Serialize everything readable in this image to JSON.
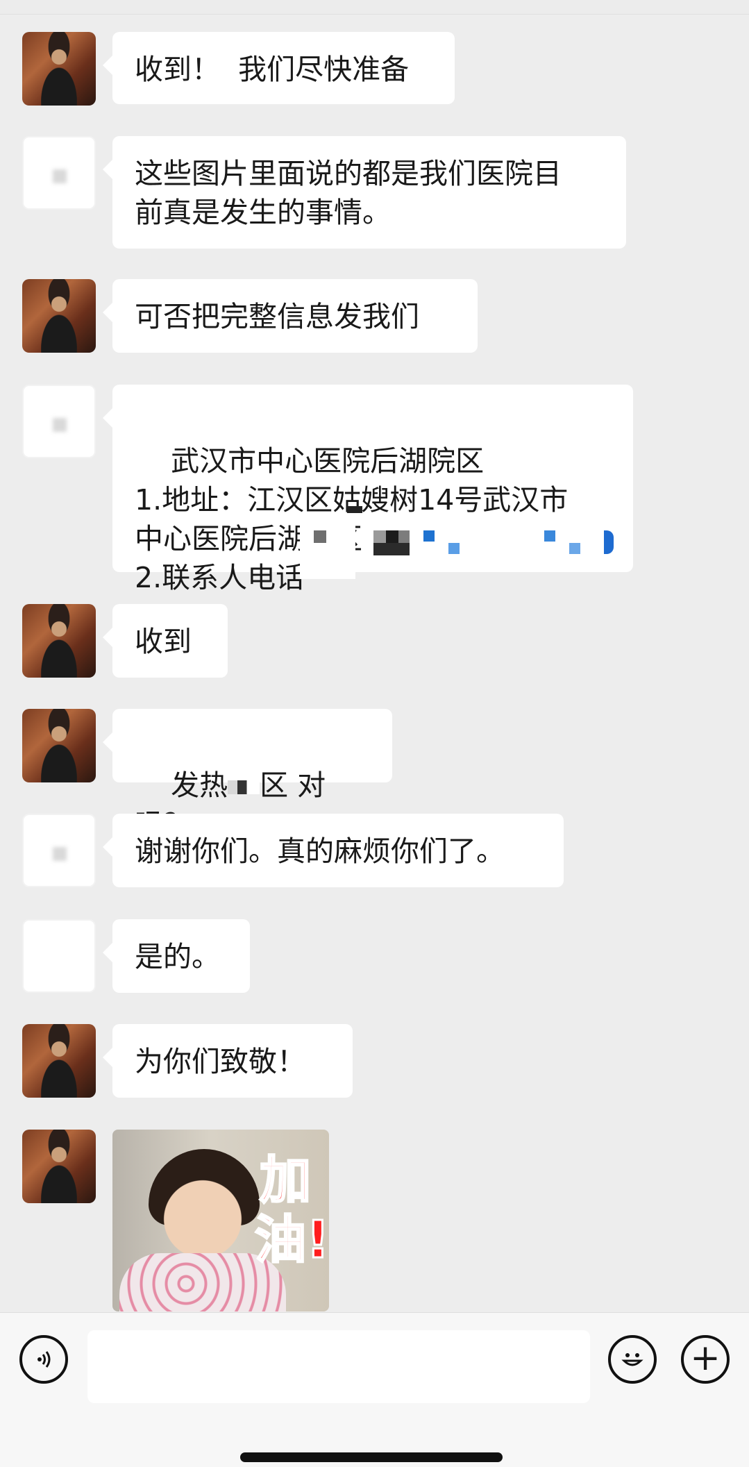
{
  "messages": [
    {
      "side": "left",
      "avatar": "photo",
      "text": "收到！  我们尽快准备"
    },
    {
      "side": "left",
      "avatar": "blank",
      "text": "这些图片里面说的都是我们医院目\n前真是发生的事情。"
    },
    {
      "side": "left",
      "avatar": "photo",
      "text": "可否把完整信息发我们"
    },
    {
      "side": "left",
      "avatar": "blank",
      "text": "武汉市中心医院后湖院区\n1.地址：江汉区姑嫂树14号武汉市\n中心医院后湖院区\n2.联系人电话"
    },
    {
      "side": "left",
      "avatar": "photo",
      "text": "收到"
    },
    {
      "side": "left",
      "avatar": "photo",
      "text": "发热",
      "text_after": "区 对吗？"
    },
    {
      "side": "left",
      "avatar": "blank",
      "text": "谢谢你们。真的麻烦你们了。"
    },
    {
      "side": "left",
      "avatar": "blank",
      "text": "是的。"
    },
    {
      "side": "left",
      "avatar": "photo",
      "text": "为你们致敬！"
    },
    {
      "side": "left",
      "avatar": "photo",
      "sticker_text": "加油!!"
    }
  ],
  "input_bar": {
    "voice_icon": "voice-icon",
    "emoji_icon": "emoji-icon",
    "plus_icon": "plus-icon",
    "input_value": "",
    "plus_symbol": "+",
    "emoji_symbol": "☺"
  },
  "colors": {
    "background": "#ededed",
    "bubble": "#ffffff",
    "text": "#191919",
    "sticker_red": "#ff1d1d"
  }
}
